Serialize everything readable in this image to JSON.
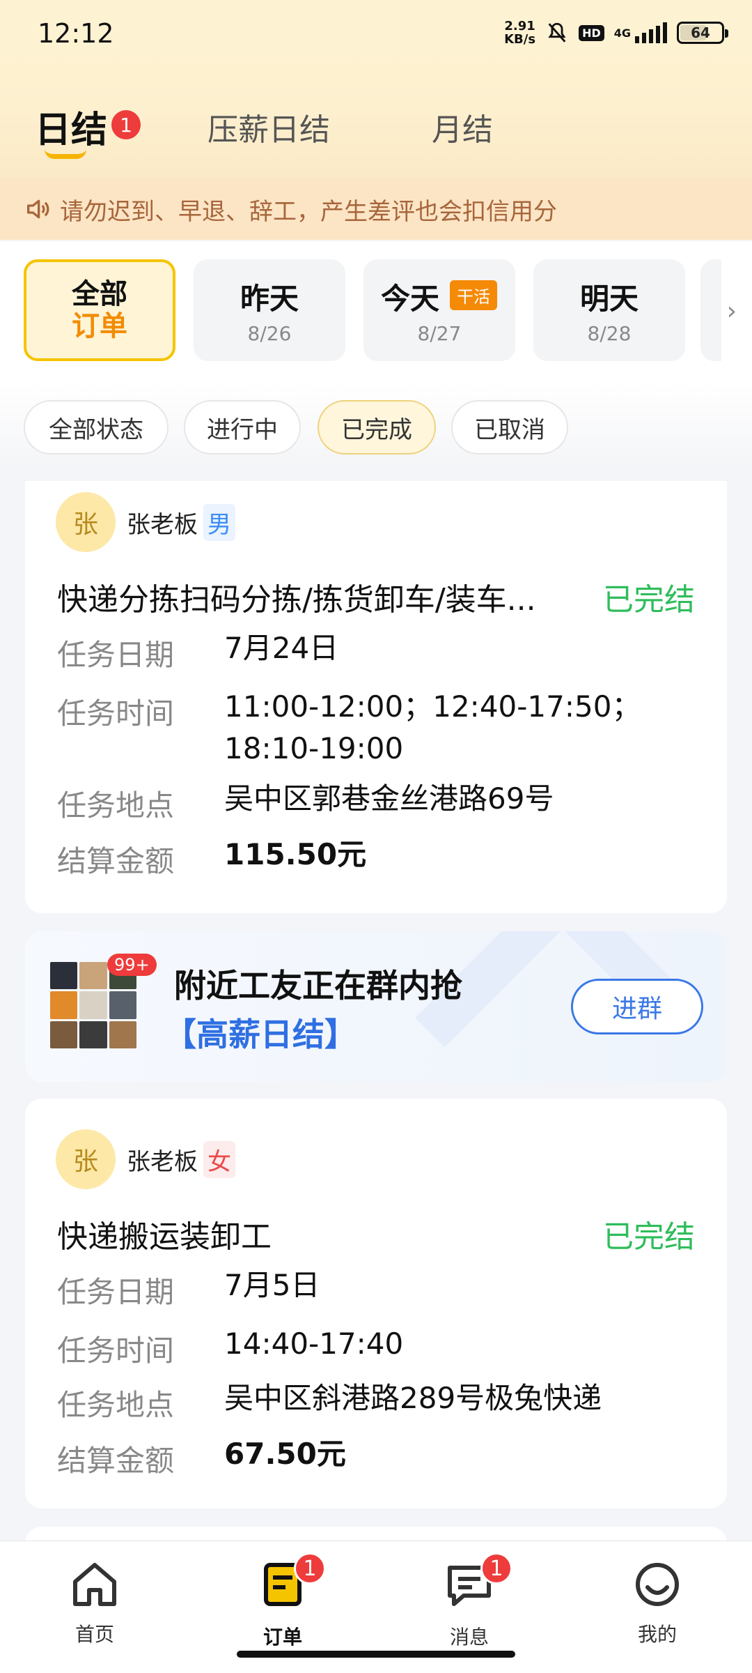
{
  "status_bar": {
    "time": "12:12",
    "net_speed_value": "2.91",
    "net_speed_unit": "KB/s",
    "hd": "HD",
    "network": "4G",
    "battery": "64"
  },
  "tabs": [
    {
      "label": "日结",
      "badge": "1",
      "active": true
    },
    {
      "label": "压薪日结"
    },
    {
      "label": "月结"
    }
  ],
  "notice": {
    "text": "请勿迟到、早退、辞工，产生差评也会扣信用分",
    "icon": "speaker-icon"
  },
  "date_filters": [
    {
      "line1": "全部",
      "line2": "订单",
      "active": true
    },
    {
      "title": "昨天",
      "date": "8/26"
    },
    {
      "title": "今天",
      "date": "8/27",
      "tag": "干活"
    },
    {
      "title": "明天",
      "date": "8/28"
    }
  ],
  "status_filters": [
    {
      "label": "全部状态"
    },
    {
      "label": "进行中"
    },
    {
      "label": "已完成",
      "active": true
    },
    {
      "label": "已取消"
    }
  ],
  "orders": [
    {
      "avatar": "张",
      "boss": "张老板",
      "gender": "男",
      "title": "快递分拣扫码分拣/拣货卸车/装车...",
      "status": "已完结",
      "fields": [
        {
          "label": "任务日期",
          "value": "7月24日"
        },
        {
          "label": "任务时间",
          "value": "11:00-12:00；12:40-17:50；",
          "value2": "18:10-19:00"
        },
        {
          "label": "任务地点",
          "value": "吴中区郭巷金丝港路69号"
        },
        {
          "label": "结算金额",
          "value": "115.50元"
        }
      ]
    },
    {
      "avatar": "张",
      "boss": "张老板",
      "gender": "女",
      "title": "快递搬运装卸工",
      "status": "已完结",
      "fields": [
        {
          "label": "任务日期",
          "value": "7月5日"
        },
        {
          "label": "任务时间",
          "value": "14:40-17:40"
        },
        {
          "label": "任务地点",
          "value": "吴中区斜港路289号极兔快递"
        },
        {
          "label": "结算金额",
          "value": "67.50元"
        }
      ]
    }
  ],
  "group_banner": {
    "badge": "99+",
    "line1": "附近工友正在群内抢",
    "line2": "【高薪日结】",
    "button": "进群"
  },
  "bottom_nav": [
    {
      "label": "首页",
      "icon": "home-icon"
    },
    {
      "label": "订单",
      "icon": "order-icon",
      "badge": "1",
      "active": true
    },
    {
      "label": "消息",
      "icon": "message-icon",
      "badge": "1"
    },
    {
      "label": "我的",
      "icon": "profile-icon"
    }
  ],
  "colors": {
    "accent": "#f5c400",
    "completed": "#2fbd5b",
    "badge": "#ee3b3b",
    "link": "#2f6fe2"
  }
}
